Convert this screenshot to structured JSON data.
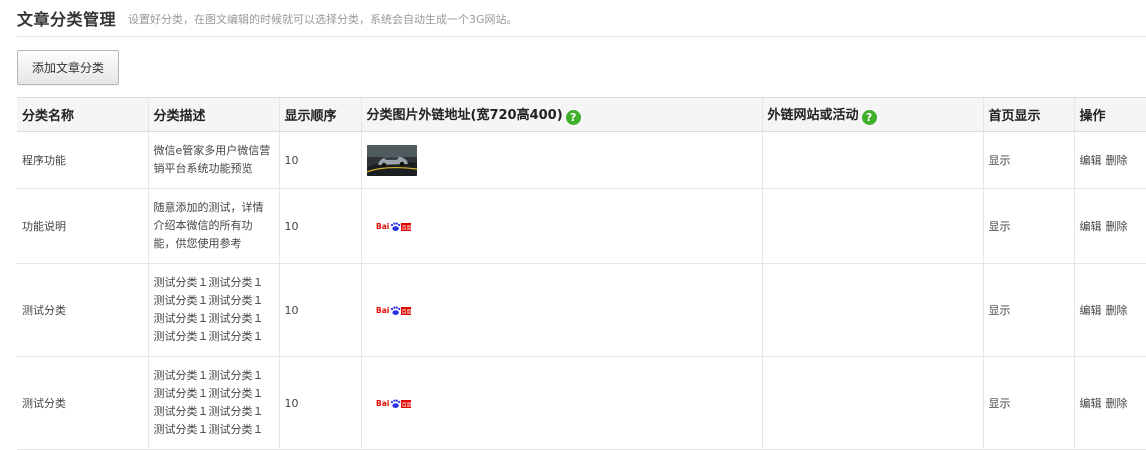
{
  "header": {
    "title": "文章分类管理",
    "subtitle": "设置好分类，在图文编辑的时候就可以选择分类，系统会自动生成一个3G网站。"
  },
  "toolbar": {
    "add_label": "添加文章分类"
  },
  "table": {
    "columns": [
      "分类名称",
      "分类描述",
      "显示顺序",
      "分类图片外链地址(宽720高400)",
      "外链网站或活动",
      "首页显示",
      "操作"
    ],
    "help_glyph": "?",
    "rows": [
      {
        "name": "程序功能",
        "desc": "微信e管家多用户微信营销平台系统功能预览",
        "order": "10",
        "image": "car-photo",
        "link": "",
        "home": "显示",
        "edit": "编辑",
        "delete": "删除"
      },
      {
        "name": "功能说明",
        "desc": "随意添加的测试，详情介绍本微信的所有功能，供您使用参考",
        "order": "10",
        "image": "baidu-logo",
        "link": "",
        "home": "显示",
        "edit": "编辑",
        "delete": "删除"
      },
      {
        "name": "测试分类",
        "desc": "测试分类１测试分类１测试分类１测试分类１测试分类１测试分类１测试分类１测试分类１",
        "order": "10",
        "image": "baidu-logo",
        "link": "",
        "home": "显示",
        "edit": "编辑",
        "delete": "删除"
      },
      {
        "name": "测试分类",
        "desc": "测试分类１测试分类１测试分类１测试分类１测试分类１测试分类１测试分类１测试分类１",
        "order": "10",
        "image": "baidu-logo",
        "link": "",
        "home": "显示",
        "edit": "编辑",
        "delete": "删除"
      }
    ]
  },
  "colors": {
    "help_badge": "#3fae2a",
    "header_bg": "#f5f5f5",
    "baidu_red": "#e10601",
    "baidu_blue": "#2932e1"
  }
}
